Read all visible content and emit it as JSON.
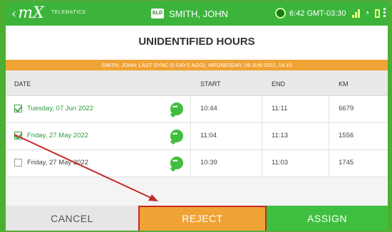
{
  "topbar": {
    "brand": "mX",
    "brand_sub": "TELEMATICS",
    "eld_badge": "ELD",
    "driver_name": "SMITH, JOHN",
    "clock": "6:42 GMT-03:30",
    "icons": [
      "back-chevron-icon",
      "sync-icon",
      "signal-icon",
      "wifi-icon",
      "battery-icon",
      "overflow-menu-icon"
    ]
  },
  "page_title": "UNIDENTIFIED HOURS",
  "sync_banner": "SMITH, JOHN: LAST SYNC (0 DAYS AGO), WEDNESDAY, 08 JUN 2022, 14:10",
  "table": {
    "headers": {
      "date": "DATE",
      "start": "START",
      "end": "END",
      "km": "KM"
    },
    "rows": [
      {
        "checked": true,
        "date": "Tuesday, 07 Jun 2022",
        "start": "10:44",
        "end": "11:11",
        "km": "6679"
      },
      {
        "checked": true,
        "date": "Friday, 27 May 2022",
        "start": "11:04",
        "end": "11:13",
        "km": "1556"
      },
      {
        "checked": false,
        "date": "Friday, 27 May 2022",
        "start": "10:39",
        "end": "11:03",
        "km": "1745"
      }
    ]
  },
  "buttons": {
    "cancel": "CANCEL",
    "reject": "REJECT",
    "assign": "ASSIGN"
  },
  "colors": {
    "topbar": "#3cb43c",
    "banner": "#f0a335",
    "reject": "#f0a335",
    "reject_outline": "#c62828",
    "assign": "#3fbf3f",
    "checked": "#43a047",
    "annotation_arrow": "#c62828"
  }
}
